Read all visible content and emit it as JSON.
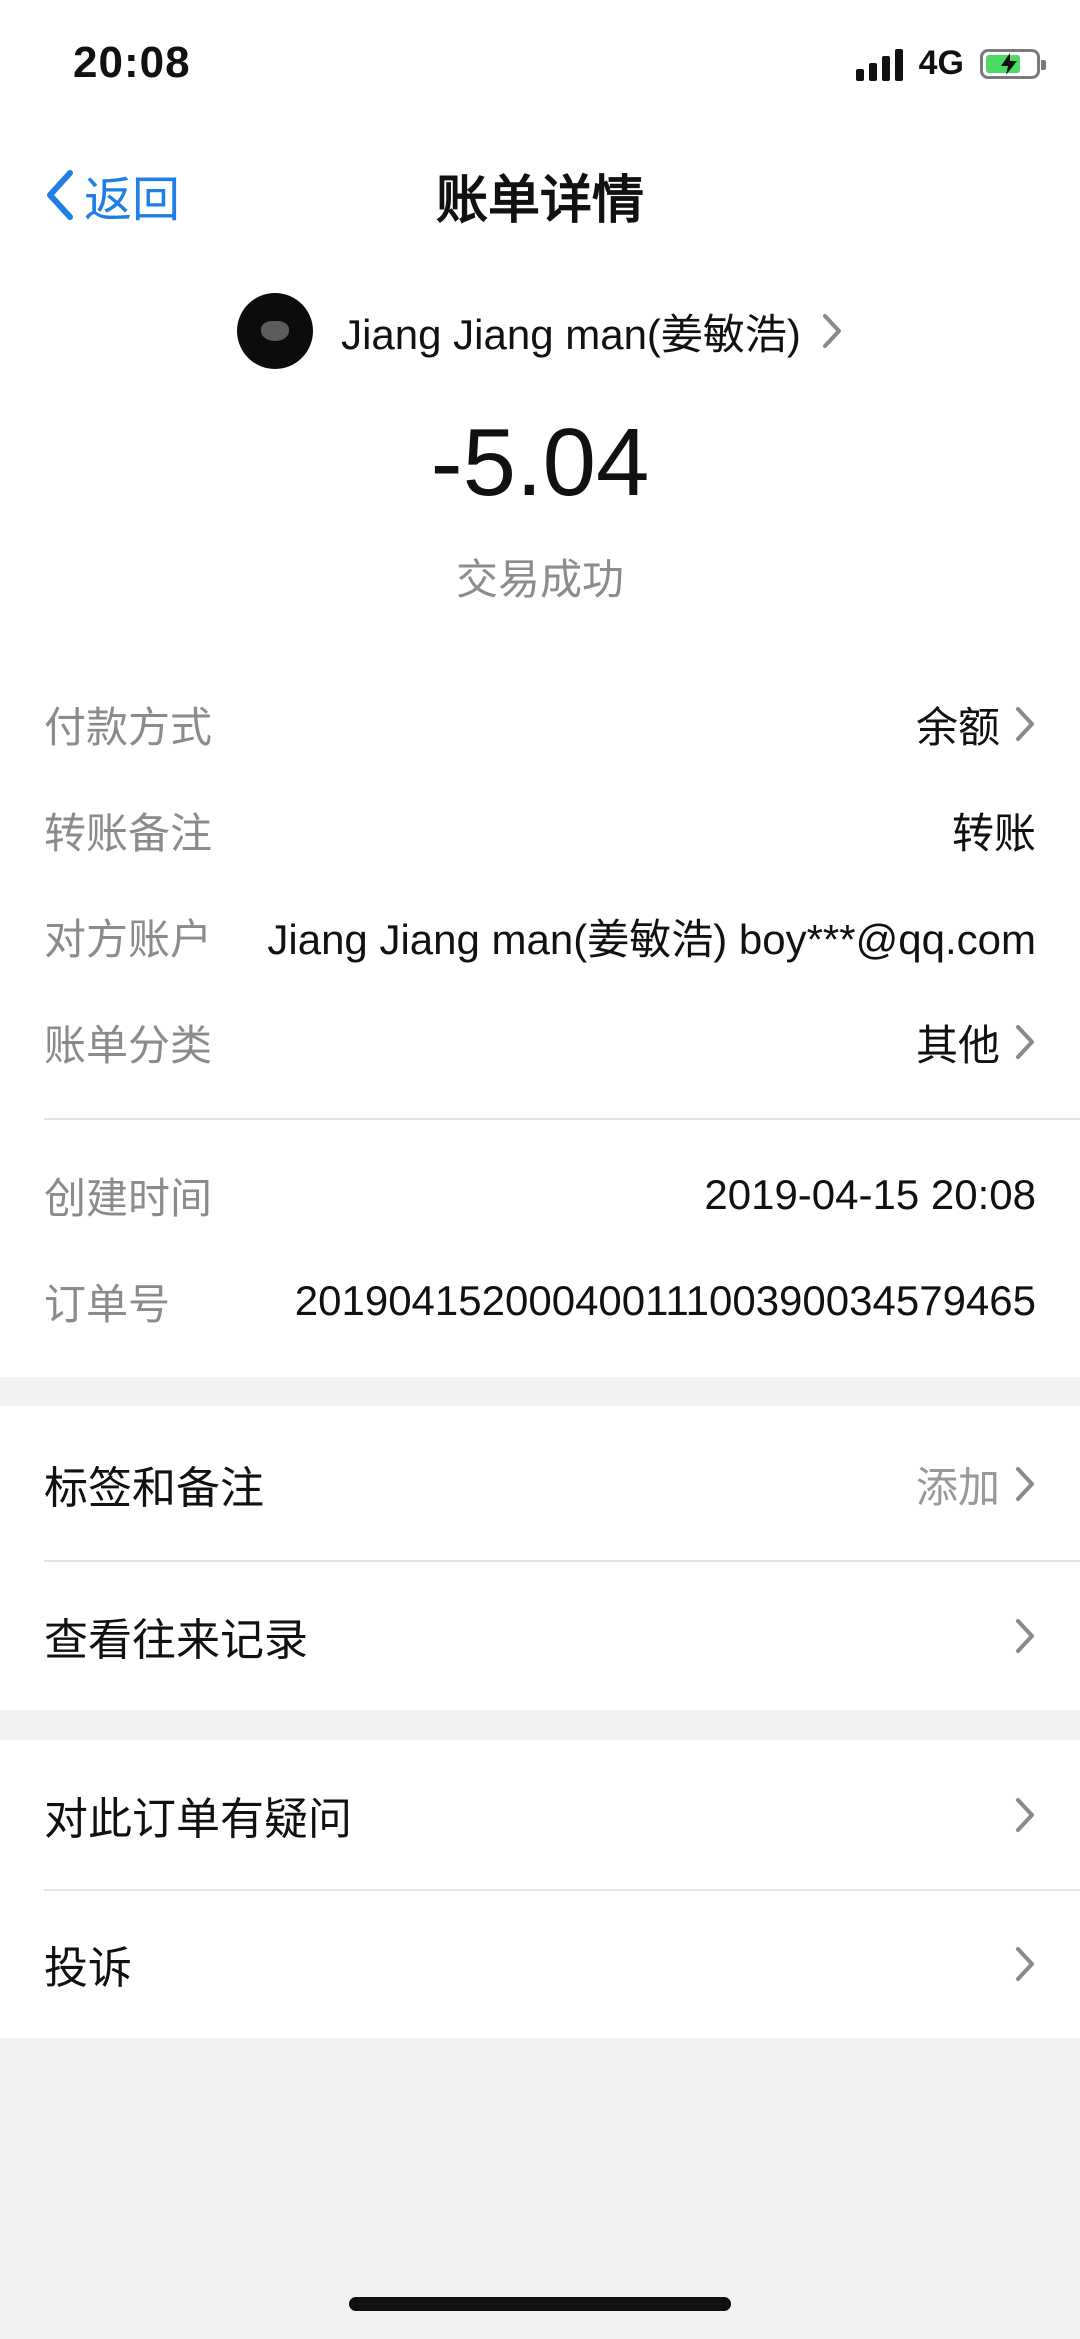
{
  "status_bar": {
    "time": "20:08",
    "network": "4G"
  },
  "nav": {
    "back_label": "返回",
    "title": "账单详情"
  },
  "payee": {
    "name": "Jiang Jiang man(姜敏浩)"
  },
  "amount": "-5.04",
  "trade_status": "交易成功",
  "details": [
    {
      "label": "付款方式",
      "value": "余额"
    },
    {
      "label": "转账备注",
      "value": "转账"
    },
    {
      "label": "对方账户",
      "value": "Jiang Jiang man(姜敏浩) boy***@qq.com"
    },
    {
      "label": "账单分类",
      "value": "其他"
    }
  ],
  "meta": [
    {
      "label": "创建时间",
      "value": "2019-04-15 20:08"
    },
    {
      "label": "订单号",
      "value": "20190415200040011100390034579465"
    }
  ],
  "menu_1": [
    {
      "label": "标签和备注",
      "hint": "添加"
    },
    {
      "label": "查看往来记录"
    }
  ],
  "menu_2": [
    {
      "label": "对此订单有疑问"
    },
    {
      "label": "投诉"
    }
  ]
}
